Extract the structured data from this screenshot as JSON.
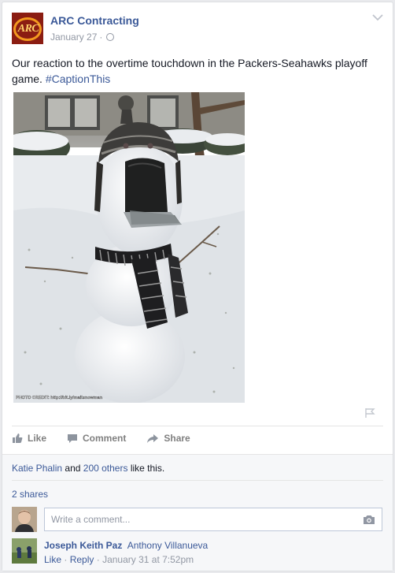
{
  "post": {
    "page_name": "ARC Contracting",
    "logo_text": "ARC",
    "date": "January 27",
    "separator": "·",
    "text": "Our reaction to the overtime touchdown in the Packers-Seahawks playoff game.",
    "hashtag": "#CaptionThis",
    "photo_credit": "PHOTO CREDIT: http://bit.ly/mailsnowman"
  },
  "actions": {
    "like": "Like",
    "comment": "Comment",
    "share": "Share"
  },
  "footer": {
    "liker": "Katie Phalin",
    "and": "and",
    "others": "200 others",
    "like_suffix": "like this.",
    "shares": "2 shares",
    "comment_placeholder": "Write a comment..."
  },
  "comment": {
    "author": "Joseph Keith Paz",
    "mention": "Anthony Villanueva",
    "like": "Like",
    "reply": "Reply",
    "sep": "·",
    "time": "January 31 at 7:52pm"
  },
  "colors": {
    "link": "#3b5998",
    "muted": "#9197a3",
    "background": "#e9eaed"
  }
}
